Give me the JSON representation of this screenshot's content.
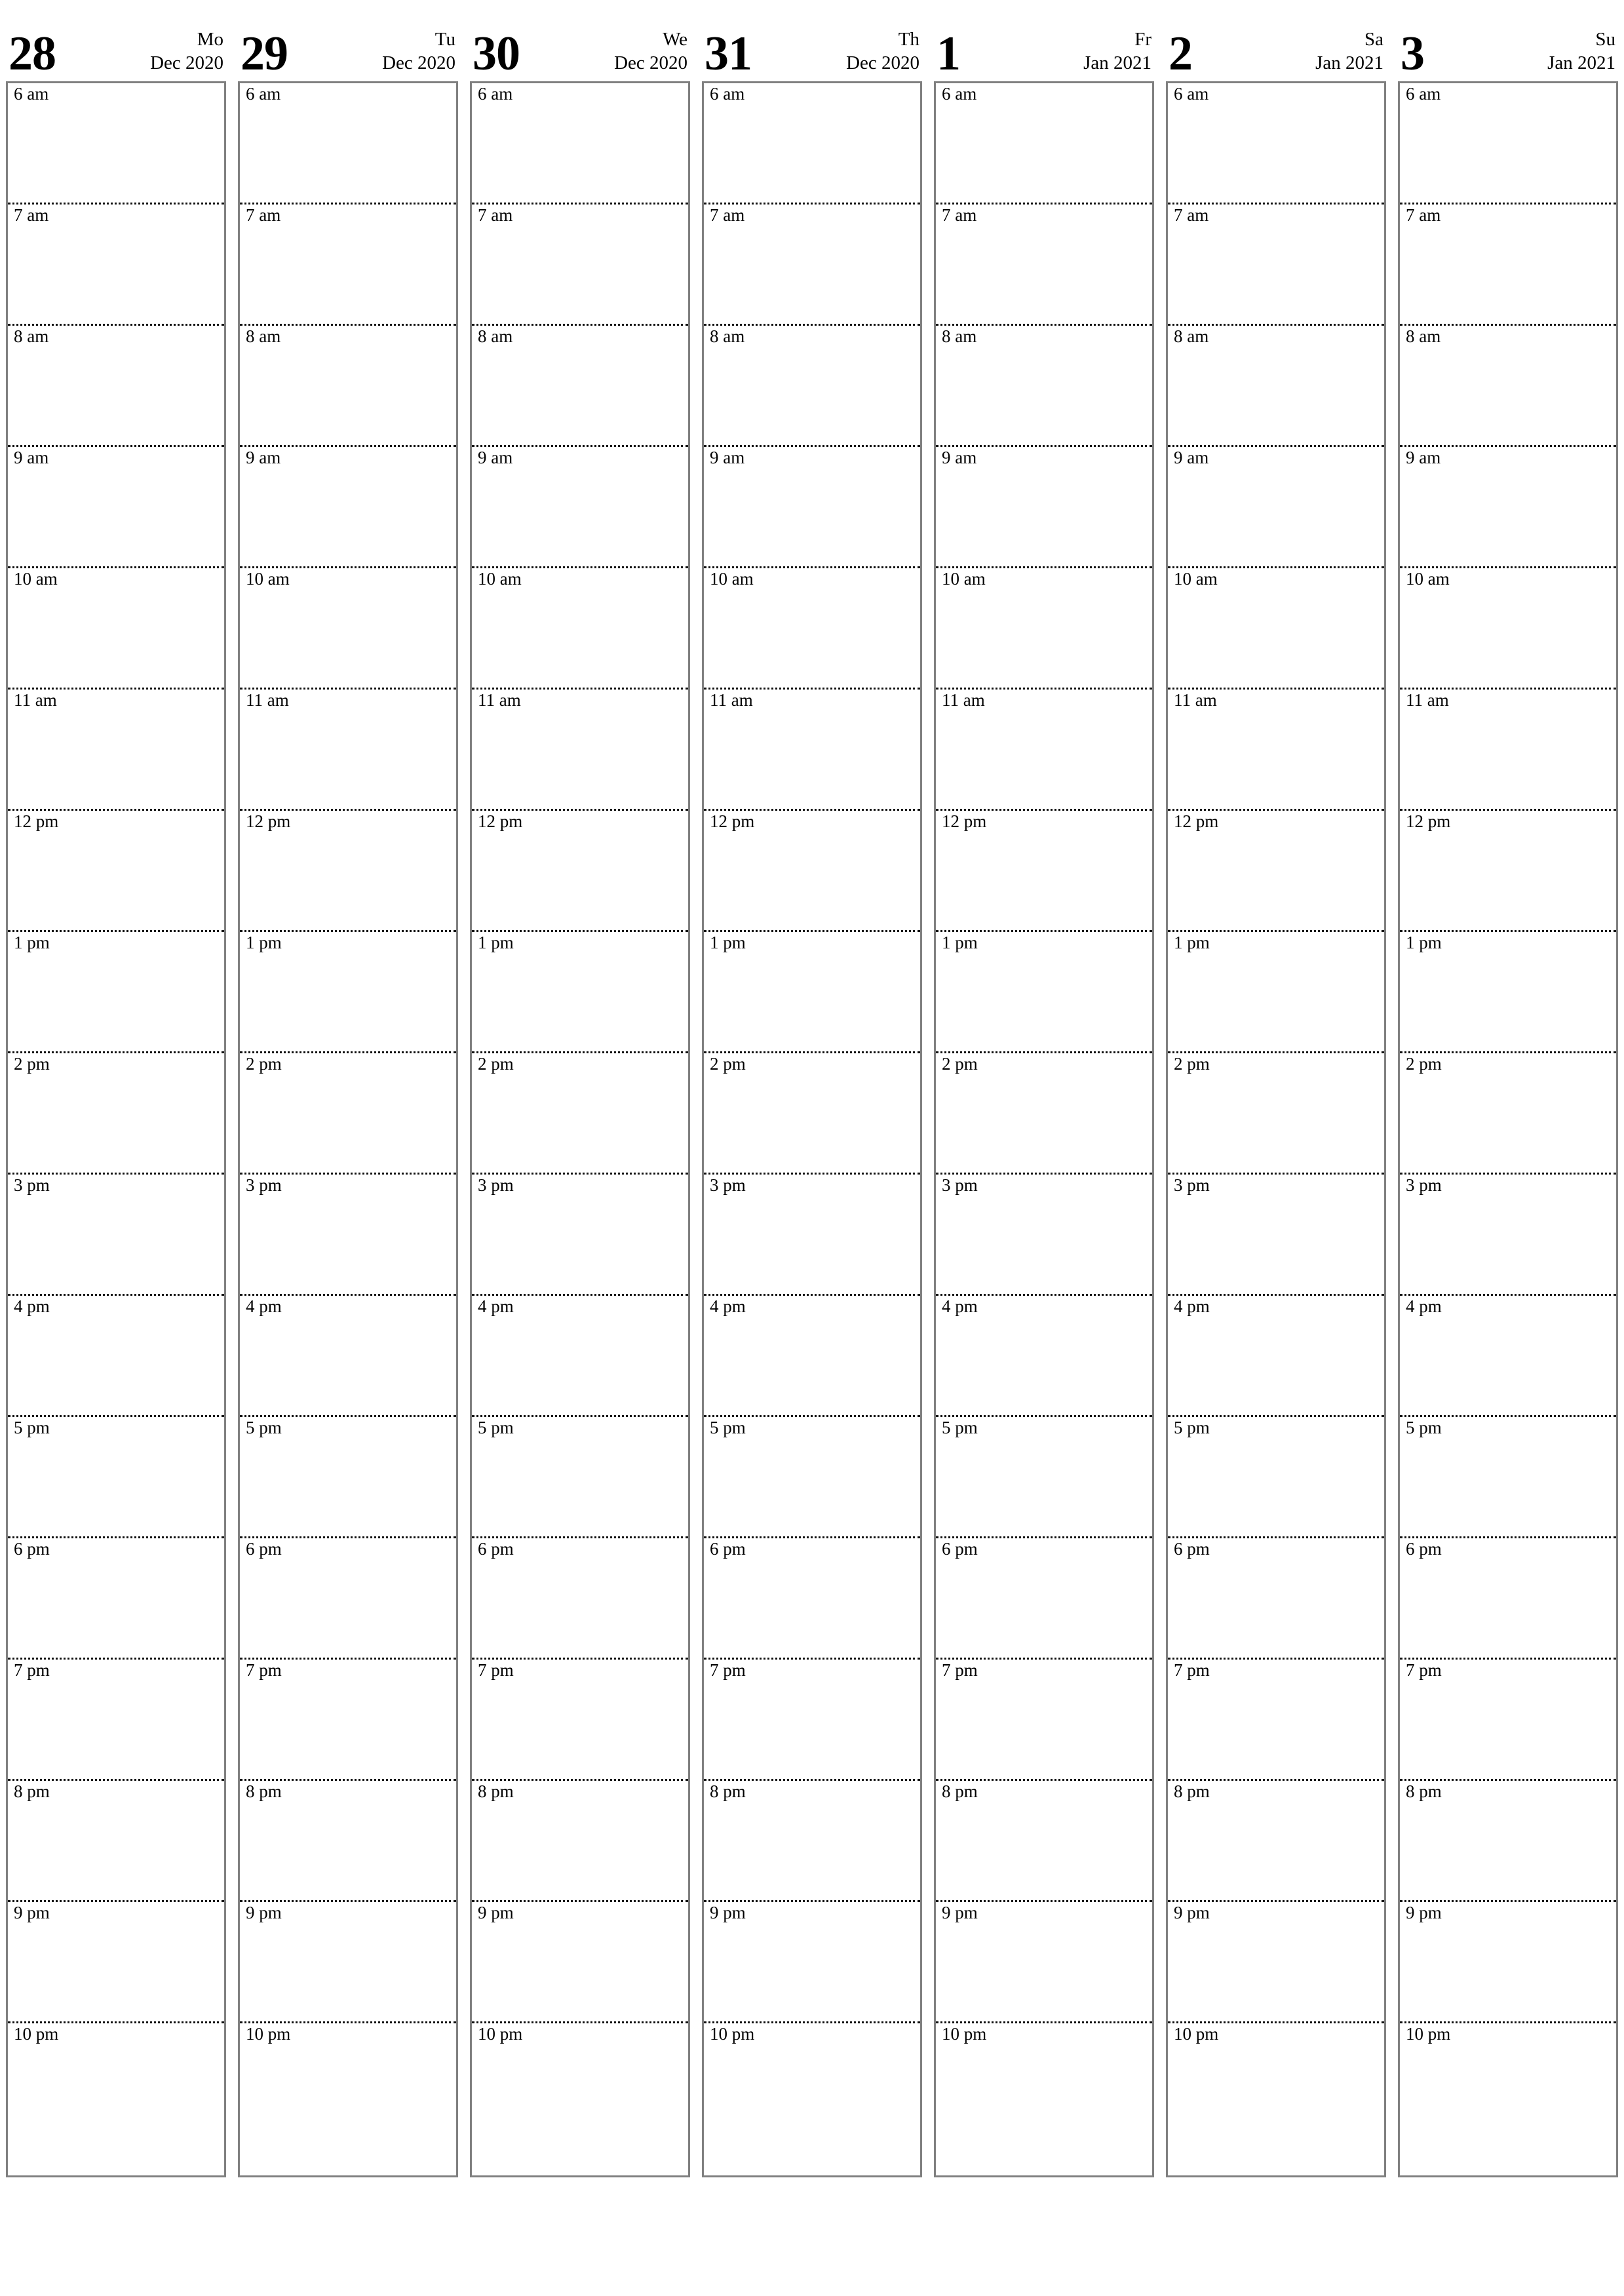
{
  "document": {
    "type": "weekly-planner",
    "orientation": "portrait",
    "page_background": "#ffffff",
    "border_color": "#808080",
    "separator_color": "#111111",
    "text_color": "#000000"
  },
  "week": {
    "days": [
      {
        "number": "28",
        "weekday": "Mo",
        "month_year": "Dec 2020"
      },
      {
        "number": "29",
        "weekday": "Tu",
        "month_year": "Dec 2020"
      },
      {
        "number": "30",
        "weekday": "We",
        "month_year": "Dec 2020"
      },
      {
        "number": "31",
        "weekday": "Th",
        "month_year": "Dec 2020"
      },
      {
        "number": "1",
        "weekday": "Fr",
        "month_year": "Jan 2021"
      },
      {
        "number": "2",
        "weekday": "Sa",
        "month_year": "Jan 2021"
      },
      {
        "number": "3",
        "weekday": "Su",
        "month_year": "Jan 2021"
      }
    ]
  },
  "hours": [
    "6 am",
    "7 am",
    "8 am",
    "9 am",
    "10 am",
    "11 am",
    "12 pm",
    "1 pm",
    "2 pm",
    "3 pm",
    "4 pm",
    "5 pm",
    "6 pm",
    "7 pm",
    "8 pm",
    "9 pm",
    "10 pm"
  ]
}
